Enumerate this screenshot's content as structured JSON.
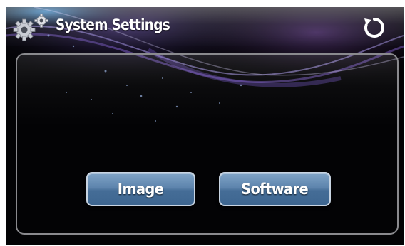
{
  "header": {
    "title": "System Settings",
    "left_icon": "gears-icon",
    "right_icon": "refresh-icon"
  },
  "buttons": {
    "image_label": "Image",
    "software_label": "Software"
  },
  "colors": {
    "background": "#030305",
    "button_fill": "#5d84ad",
    "button_border": "#c8d4e2",
    "panel_border": "#8a8a8e",
    "text": "#ffffff"
  }
}
